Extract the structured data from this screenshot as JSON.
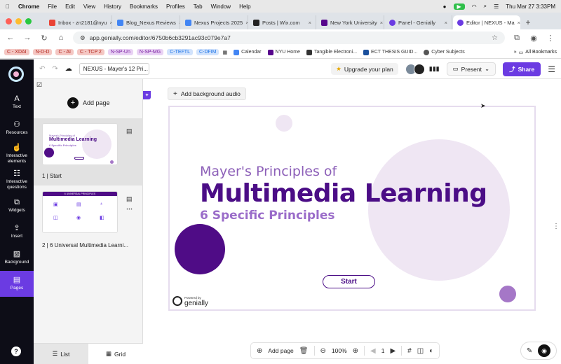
{
  "macbar": {
    "app": "Chrome",
    "menus": [
      "File",
      "Edit",
      "View",
      "History",
      "Bookmarks",
      "Profiles",
      "Tab",
      "Window",
      "Help"
    ],
    "datetime": "Thu Mar 27  3:33PM"
  },
  "tabs": [
    {
      "label": "Inbox - zn2181@nyu",
      "color": "#ea4335"
    },
    {
      "label": "Blog_Nexus Reviews",
      "color": "#4285f4"
    },
    {
      "label": "Nexus Projects 2025",
      "color": "#4285f4"
    },
    {
      "label": "Posts | Wix.com",
      "color": "#222222"
    },
    {
      "label": "New York University",
      "color": "#57068c"
    },
    {
      "label": "Panel - Genially",
      "color": "#6b3be2"
    },
    {
      "label": "Editor | NEXUS - Ma",
      "color": "#6b3be2"
    }
  ],
  "address": {
    "url": "app.genially.com/editor/6750b6cb3291ac93c079e7a7"
  },
  "bookmarks": {
    "chips": [
      {
        "label": "C - XDAI",
        "bg": "#f4c7c3",
        "fg": "#b3261e"
      },
      {
        "label": "N-D-D",
        "bg": "#f4c7c3",
        "fg": "#b3261e"
      },
      {
        "label": "C - AI",
        "bg": "#f4c7c3",
        "fg": "#b3261e"
      },
      {
        "label": "C - TCP 2",
        "bg": "#f4c7c3",
        "fg": "#b3261e"
      },
      {
        "label": "N-SP-Un",
        "bg": "#e9d2f4",
        "fg": "#7b1fa2"
      },
      {
        "label": "N-SP-MG",
        "bg": "#e9d2f4",
        "fg": "#7b1fa2"
      },
      {
        "label": "C-TEFTL",
        "bg": "#d2e3fc",
        "fg": "#1a73e8"
      },
      {
        "label": "C-DFIM",
        "bg": "#d2e3fc",
        "fg": "#1a73e8"
      }
    ],
    "items": [
      "Calendar",
      "NYU Home",
      "Tangible Electroni...",
      "ECT THESIS GUID...",
      "Cyber Subjects"
    ],
    "all": "All Bookmarks"
  },
  "sidebar": {
    "items": [
      {
        "icon": "A",
        "label": "Text"
      },
      {
        "icon": "⚇",
        "label": "Resources"
      },
      {
        "icon": "☝",
        "label": "Interactive elements"
      },
      {
        "icon": "☷",
        "label": "Interactive questions"
      },
      {
        "icon": "⧉",
        "label": "Widgets"
      },
      {
        "icon": "⇪",
        "label": "Insert"
      },
      {
        "icon": "▨",
        "label": "Background"
      },
      {
        "icon": "▤",
        "label": "Pages"
      }
    ],
    "help": "?"
  },
  "topbar": {
    "doc_name": "NEXUS - Mayer's 12 Pri...",
    "upgrade": "Upgrade your plan",
    "present": "Present",
    "share": "Share"
  },
  "pages": {
    "add_page": "Add page",
    "list": [
      {
        "label": "1 | Start"
      },
      {
        "label": "2 | 6 Universal Multimedia Learni..."
      }
    ],
    "view_list": "List",
    "view_grid": "Grid"
  },
  "thumb1": {
    "line1": "Mayer's Principles of",
    "line2": "Multimedia Learning",
    "line3": "6 Specific Principles"
  },
  "thumb2": {
    "title": "6 UNIVERSAL PRINCIPLES"
  },
  "canvas": {
    "bg_audio": "Add background audio"
  },
  "slide": {
    "title_small": "Mayer's Principles of",
    "title_big": "Multimedia Learning",
    "subtitle": "6 Specific Principles",
    "button": "Start",
    "powered_small": "Powered by",
    "powered_brand": "genially"
  },
  "bottombar": {
    "add_page": "Add page",
    "zoom": "100%",
    "page": "1"
  },
  "colors": {
    "brand": "#6b3be2",
    "title": "#4b0d86",
    "subtitle": "#9a6cc9",
    "light_circle": "#efe6f3",
    "dark_circle": "#4f0c86",
    "mid_circle": "#a577c7"
  }
}
